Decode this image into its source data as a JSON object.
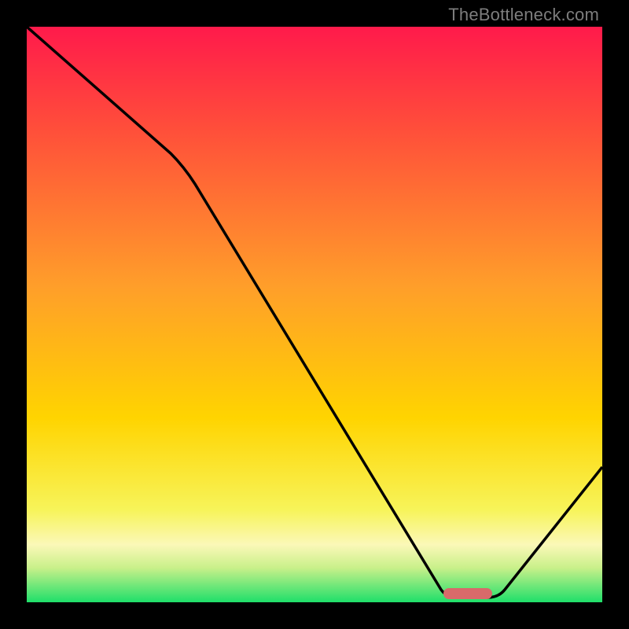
{
  "watermark": "TheBottleneck.com",
  "chart_data": {
    "type": "line",
    "title": "",
    "xlabel": "",
    "ylabel": "",
    "xlim": [
      0,
      100
    ],
    "ylim": [
      0,
      100
    ],
    "grid": false,
    "legend": false,
    "series": [
      {
        "name": "bottleneck-curve",
        "x": [
          0,
          25,
          72,
          80,
          100
        ],
        "y": [
          100,
          78,
          0,
          0,
          23
        ]
      }
    ],
    "marker": {
      "name": "optimal-range",
      "x_start": 73,
      "x_end": 81,
      "y": 1.2,
      "color": "#d86a6a"
    },
    "background_gradient": {
      "top": "#ff1a4b",
      "mid": "#ffd400",
      "low_band": "#fff8b0",
      "bottom": "#1fdf6a"
    }
  }
}
